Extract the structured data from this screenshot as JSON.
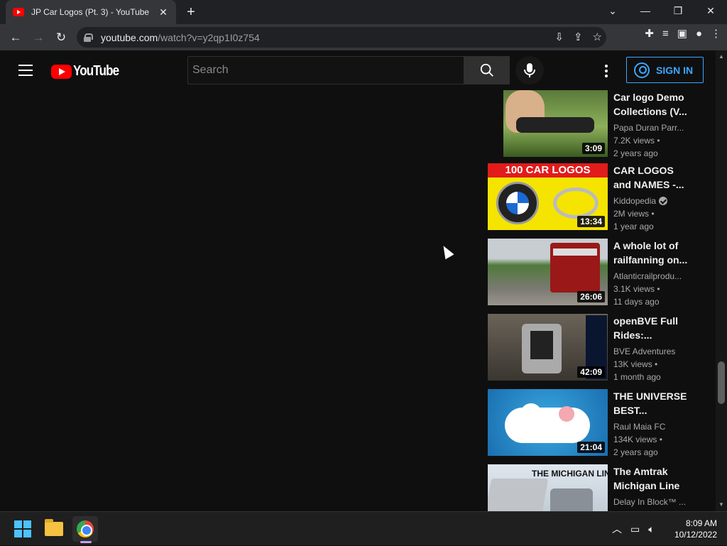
{
  "browser": {
    "tab_title": "JP Car Logos (Pt. 3) - YouTube",
    "url_host": "youtube.com",
    "url_path": "/watch?v=y2qp1I0z754"
  },
  "youtube": {
    "logo_text": "YouTube",
    "search_placeholder": "Search",
    "sign_in_label": "SIGN IN"
  },
  "videos": [
    {
      "title": "Car logo Demo Collections (V...",
      "channel": "Papa Duran Parr...",
      "views": "7.2K views •",
      "age": "2 years ago",
      "duration": "3:09",
      "verified": false
    },
    {
      "title": "CAR LOGOS and NAMES -...",
      "channel": "Kiddopedia",
      "views": "2M views •",
      "age": "1 year ago",
      "duration": "13:34",
      "verified": true,
      "thumb_text": "100 CAR LOGOS"
    },
    {
      "title": "A whole lot of railfanning on...",
      "channel": "Atlanticrailprodu...",
      "views": "3.1K views •",
      "age": "11 days ago",
      "duration": "26:06",
      "verified": false
    },
    {
      "title": "openBVE Full Rides:...",
      "channel": "BVE Adventures",
      "views": "13K views •",
      "age": "1 month ago",
      "duration": "42:09",
      "verified": false
    },
    {
      "title": "THE UNIVERSE BEST...",
      "channel": "Raul Maia FC",
      "views": "134K views •",
      "age": "2 years ago",
      "duration": "21:04",
      "verified": false
    },
    {
      "title": "The Amtrak Michigan Line",
      "channel": "Delay In Block™ ...",
      "views": "",
      "age": "",
      "duration": "",
      "verified": false,
      "thumb_text": "THE MICHIGAN LINE"
    }
  ],
  "taskbar": {
    "time": "8:09 AM",
    "date": "10/12/2022"
  },
  "colors": {
    "accent_blue": "#3ea6ff",
    "yt_red": "#ff0000",
    "background": "#0f0f0f"
  }
}
